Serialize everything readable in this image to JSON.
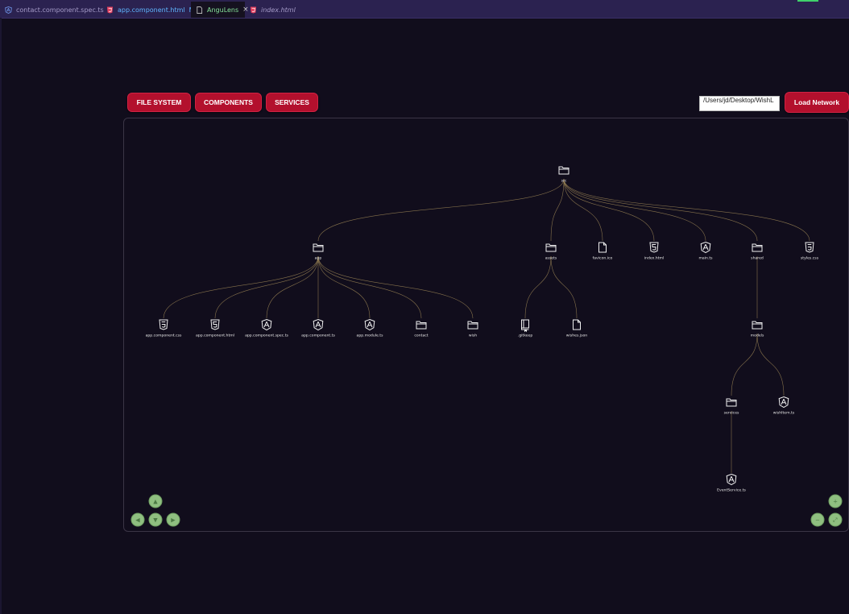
{
  "tabs": [
    {
      "label": "contact.component.spec.ts",
      "icon": "angular-icon",
      "color": "#a59bc8"
    },
    {
      "label": "app.component.html",
      "badge": "M",
      "icon": "html-icon",
      "color": "#5fb6ff"
    },
    {
      "label": "AnguLens",
      "icon": "file-icon",
      "close": "×",
      "color": "#86e39a"
    },
    {
      "label": "index.html",
      "icon": "html-icon",
      "color": "#a59bc8"
    }
  ],
  "toolbar": {
    "file_system": "FILE SYSTEM",
    "components": "COMPONENTS",
    "services": "SERVICES",
    "path_value": "/Users/jd/Desktop/WishL",
    "load_network": "Load Network"
  },
  "colors": {
    "accent": "#b3102d",
    "edge": "#9a8455",
    "node": "#eeeeee"
  },
  "tree": {
    "nodes": [
      {
        "id": "src",
        "label": "src",
        "icon": "folder-icon"
      },
      {
        "id": "app",
        "label": "app",
        "icon": "folder-icon"
      },
      {
        "id": "assets",
        "label": "assets",
        "icon": "folder-icon"
      },
      {
        "id": "favicon",
        "label": "favicon.ico",
        "icon": "file-icon"
      },
      {
        "id": "indexhtml",
        "label": "index.html",
        "icon": "html-icon"
      },
      {
        "id": "maints",
        "label": "main.ts",
        "icon": "angular-icon"
      },
      {
        "id": "shared",
        "label": "shared",
        "icon": "folder-icon"
      },
      {
        "id": "styles",
        "label": "styles.css",
        "icon": "css-icon"
      },
      {
        "id": "appcss",
        "label": "app.component.css",
        "icon": "css-icon"
      },
      {
        "id": "apphtml",
        "label": "app.component.html",
        "icon": "html-icon"
      },
      {
        "id": "appspec",
        "label": "app.component.spec.ts",
        "icon": "angular-icon"
      },
      {
        "id": "appts",
        "label": "app.component.ts",
        "icon": "angular-icon"
      },
      {
        "id": "appmodule",
        "label": "app.module.ts",
        "icon": "angular-icon"
      },
      {
        "id": "contact",
        "label": "contact",
        "icon": "folder-icon"
      },
      {
        "id": "wish",
        "label": "wish",
        "icon": "folder-icon"
      },
      {
        "id": "gitkeep",
        "label": ".gitkeep",
        "icon": "book-icon"
      },
      {
        "id": "wishes",
        "label": "wishes.json",
        "icon": "file-icon"
      },
      {
        "id": "models",
        "label": "models",
        "icon": "folder-icon"
      },
      {
        "id": "services",
        "label": "services",
        "icon": "folder-icon"
      },
      {
        "id": "wishitem",
        "label": "wishItem.ts",
        "icon": "angular-icon"
      },
      {
        "id": "eventservice",
        "label": "EventService.ts",
        "icon": "angular-icon"
      }
    ],
    "edges": [
      [
        "src",
        "app"
      ],
      [
        "src",
        "assets"
      ],
      [
        "src",
        "favicon"
      ],
      [
        "src",
        "indexhtml"
      ],
      [
        "src",
        "maints"
      ],
      [
        "src",
        "shared"
      ],
      [
        "src",
        "styles"
      ],
      [
        "app",
        "appcss"
      ],
      [
        "app",
        "apphtml"
      ],
      [
        "app",
        "appspec"
      ],
      [
        "app",
        "appts"
      ],
      [
        "app",
        "appmodule"
      ],
      [
        "app",
        "contact"
      ],
      [
        "app",
        "wish"
      ],
      [
        "assets",
        "gitkeep"
      ],
      [
        "assets",
        "wishes"
      ],
      [
        "shared",
        "models"
      ],
      [
        "models",
        "services"
      ],
      [
        "models",
        "wishitem"
      ],
      [
        "services",
        "eventservice"
      ]
    ]
  },
  "nav_controls": {
    "left": [
      "up-icon",
      "left-icon",
      "down-icon",
      "right-icon"
    ],
    "right": [
      "zoom-in-icon",
      "zoom-out-icon",
      "fit-icon"
    ]
  }
}
